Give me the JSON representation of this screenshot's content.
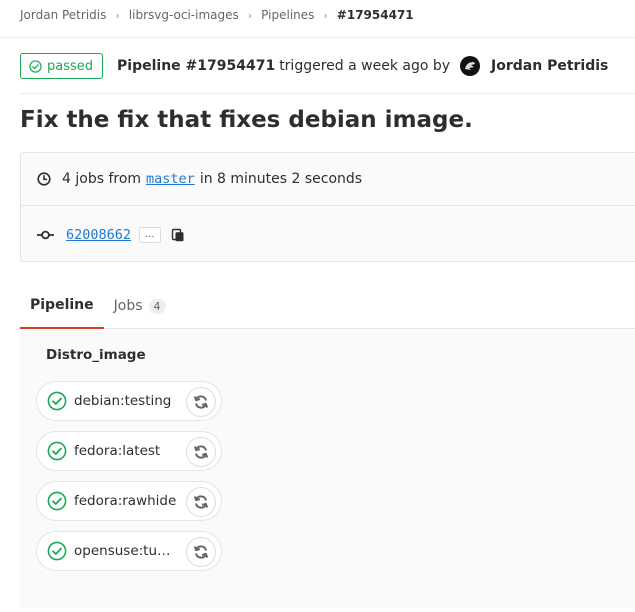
{
  "breadcrumb": {
    "items": [
      "Jordan Petridis",
      "librsvg-oci-images",
      "Pipelines",
      "#17954471"
    ]
  },
  "status": {
    "badge_label": "passed",
    "pipeline_label": "Pipeline #17954471",
    "trigger_text": "triggered a week ago by",
    "author": "Jordan Petridis",
    "accent_color": "#1aaa55"
  },
  "title": "Fix the fix that fixes debian image.",
  "info": {
    "jobs_text": "4 jobs from",
    "branch": "master",
    "duration_text": "in 8 minutes 2 seconds",
    "commit_sha": "62008662",
    "ellipsis": "..."
  },
  "tabs": {
    "pipeline": "Pipeline",
    "jobs": "Jobs",
    "jobs_count": "4"
  },
  "graph": {
    "stage": "Distro_image",
    "jobs": [
      {
        "name": "debian:testing",
        "status": "passed"
      },
      {
        "name": "fedora:latest",
        "status": "passed"
      },
      {
        "name": "fedora:rawhide",
        "status": "passed"
      },
      {
        "name": "opensuse:tumbl...",
        "status": "passed"
      }
    ]
  }
}
